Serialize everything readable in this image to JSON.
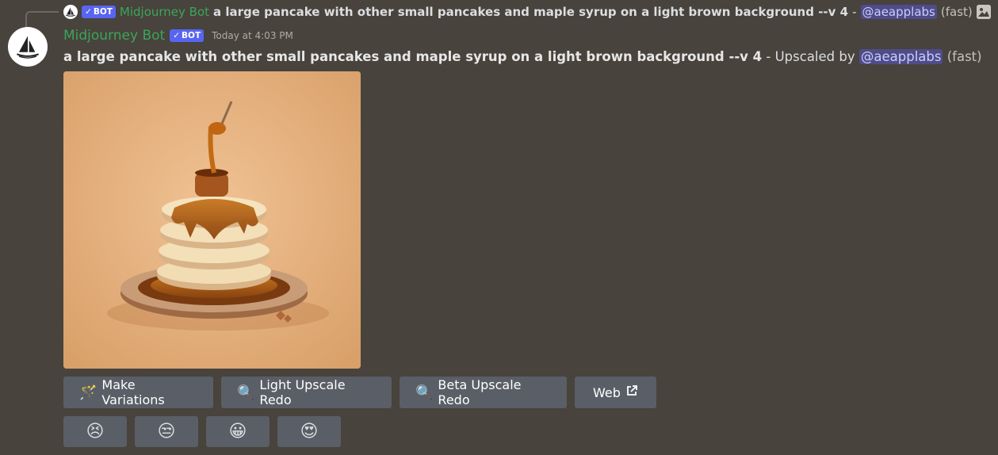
{
  "reply": {
    "bot_name": "Midjourney Bot",
    "badge": "BOT",
    "prompt": "a large pancake with other small pancakes and maple syrup on a light brown background --v 4",
    "separator": "-",
    "mention": "@aeapplabs",
    "speed": "(fast)"
  },
  "message": {
    "author": "Midjourney Bot",
    "badge": "BOT",
    "timestamp": "Today at 4:03 PM",
    "prompt": "a large pancake with other small pancakes and maple syrup on a light brown background --v 4",
    "upscaled_by": " - Upscaled by ",
    "mention": "@aeapplabs",
    "speed": "(fast)"
  },
  "buttons": [
    {
      "label": "Make Variations",
      "icon": "magic-wand-icon"
    },
    {
      "label": "Light Upscale Redo",
      "icon": "magnifier-icon"
    },
    {
      "label": "Beta Upscale Redo",
      "icon": "magnifier-icon"
    },
    {
      "label": "Web",
      "icon": "external-link-icon"
    }
  ],
  "reactions": [
    {
      "emoji": "😣",
      "name": "persevere-emoji"
    },
    {
      "emoji": "😒",
      "name": "unamused-emoji"
    },
    {
      "emoji": "😀",
      "name": "grinning-emoji"
    },
    {
      "emoji": "😍",
      "name": "heart-eyes-emoji"
    }
  ],
  "colors": {
    "background": "#48433c",
    "author": "#3ba55c",
    "badge": "#5865f2",
    "button": "#5a5e66",
    "mention_bg": "#4f4c8a"
  }
}
